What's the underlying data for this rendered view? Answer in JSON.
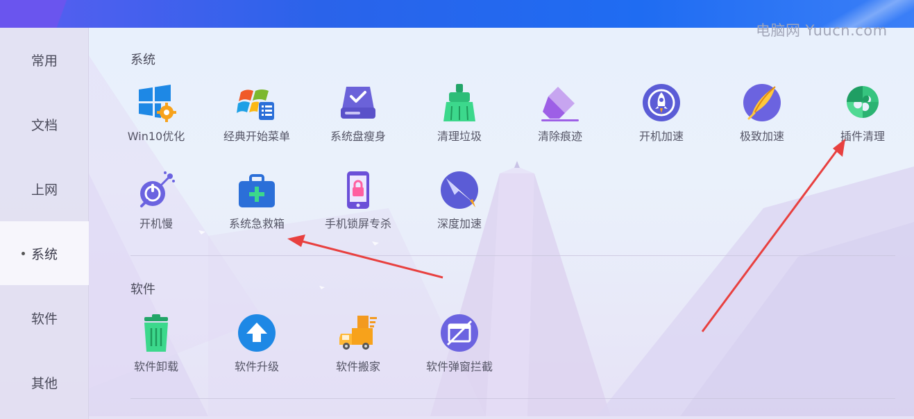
{
  "watermark": "电脑网 Yuucn.com",
  "sidebar": {
    "items": [
      {
        "label": "常用",
        "active": false
      },
      {
        "label": "文档",
        "active": false
      },
      {
        "label": "上网",
        "active": false
      },
      {
        "label": "系统",
        "active": true
      },
      {
        "label": "软件",
        "active": false
      },
      {
        "label": "其他",
        "active": false
      }
    ]
  },
  "sections": {
    "system": {
      "title": "系统",
      "tools": [
        {
          "label": "Win10优化",
          "icon": "windows-gear-icon"
        },
        {
          "label": "经典开始菜单",
          "icon": "start-menu-icon"
        },
        {
          "label": "系统盘瘦身",
          "icon": "disk-check-icon"
        },
        {
          "label": "清理垃圾",
          "icon": "broom-icon"
        },
        {
          "label": "清除痕迹",
          "icon": "eraser-icon"
        },
        {
          "label": "开机加速",
          "icon": "rocket-icon"
        },
        {
          "label": "极致加速",
          "icon": "feather-icon"
        },
        {
          "label": "插件清理",
          "icon": "puzzle-icon"
        },
        {
          "label": "开机慢",
          "icon": "power-slow-icon"
        },
        {
          "label": "系统急救箱",
          "icon": "first-aid-kit-icon"
        },
        {
          "label": "手机锁屏专杀",
          "icon": "phone-lock-icon"
        },
        {
          "label": "深度加速",
          "icon": "compass-icon"
        }
      ]
    },
    "software": {
      "title": "软件",
      "tools": [
        {
          "label": "软件卸载",
          "icon": "trash-icon"
        },
        {
          "label": "软件升级",
          "icon": "upgrade-arrow-icon"
        },
        {
          "label": "软件搬家",
          "icon": "moving-truck-icon"
        },
        {
          "label": "软件弹窗拦截",
          "icon": "popup-block-icon"
        }
      ]
    }
  },
  "colors": {
    "topbar": "#2a63ea",
    "annotation_arrow": "#e8403f",
    "sidebar_bg": "#e2def0"
  }
}
